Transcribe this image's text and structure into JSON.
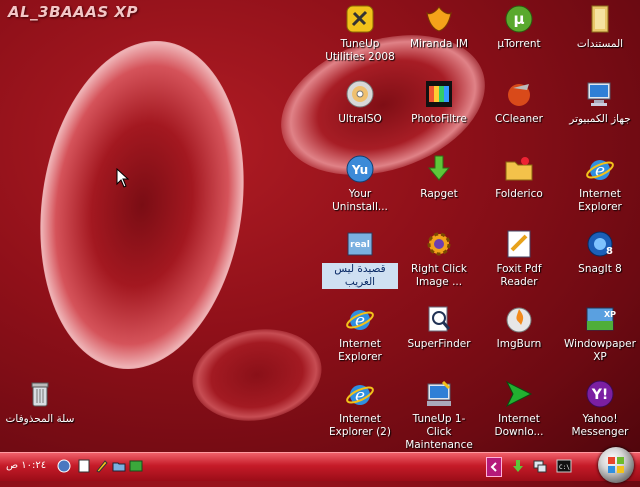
{
  "watermark": "AL_3BAAAS XP",
  "icons": [
    {
      "label": "TuneUp Utilities 2008",
      "icon": "tuneup-icon"
    },
    {
      "label": "Miranda IM",
      "icon": "miranda-icon"
    },
    {
      "label": "µTorrent",
      "icon": "utorrent-icon"
    },
    {
      "label": "المستندات",
      "icon": "documents-folder-icon"
    },
    {
      "label": "UltraISO",
      "icon": "disc-icon"
    },
    {
      "label": "PhotoFiltre",
      "icon": "photofiltre-icon"
    },
    {
      "label": "CCleaner",
      "icon": "ccleaner-icon"
    },
    {
      "label": "جهاز الكمبيوتر",
      "icon": "my-computer-icon"
    },
    {
      "label": "Your Uninstall...",
      "icon": "uninstaller-icon"
    },
    {
      "label": "Rapget",
      "icon": "download-arrow-icon"
    },
    {
      "label": "Folderico",
      "icon": "folder-icon"
    },
    {
      "label": "Internet Explorer",
      "icon": "internet-explorer-icon"
    },
    {
      "label": "قصيدة ليس الغريب",
      "icon": "realplayer-icon"
    },
    {
      "label": "Right Click Image ...",
      "icon": "gear-icon"
    },
    {
      "label": "Foxit Pdf Reader",
      "icon": "pdf-icon"
    },
    {
      "label": "SnagIt 8",
      "icon": "snagit-icon"
    },
    {
      "label": "Internet Explorer",
      "icon": "internet-explorer-icon"
    },
    {
      "label": "SuperFinder",
      "icon": "search-icon"
    },
    {
      "label": "ImgBurn",
      "icon": "imgburn-icon"
    },
    {
      "label": "Windowpaper XP",
      "icon": "windowpaper-icon"
    },
    {
      "label": "Internet Explorer (2)",
      "icon": "internet-explorer-icon"
    },
    {
      "label": "TuneUp 1-Click Maintenance",
      "icon": "tuneup-maintenance-icon"
    },
    {
      "label": "Internet Downlo...",
      "icon": "idm-icon"
    },
    {
      "label": "Yahoo! Messenger",
      "icon": "yahoo-icon"
    }
  ],
  "recycle_bin": {
    "label": "سلة المحذوفات",
    "icon": "recycle-bin-icon"
  },
  "taskbar": {
    "clock": "١٠:٢٤ ص",
    "colors": {
      "bar": "#c51b28",
      "desktop": "#8f1019"
    }
  }
}
